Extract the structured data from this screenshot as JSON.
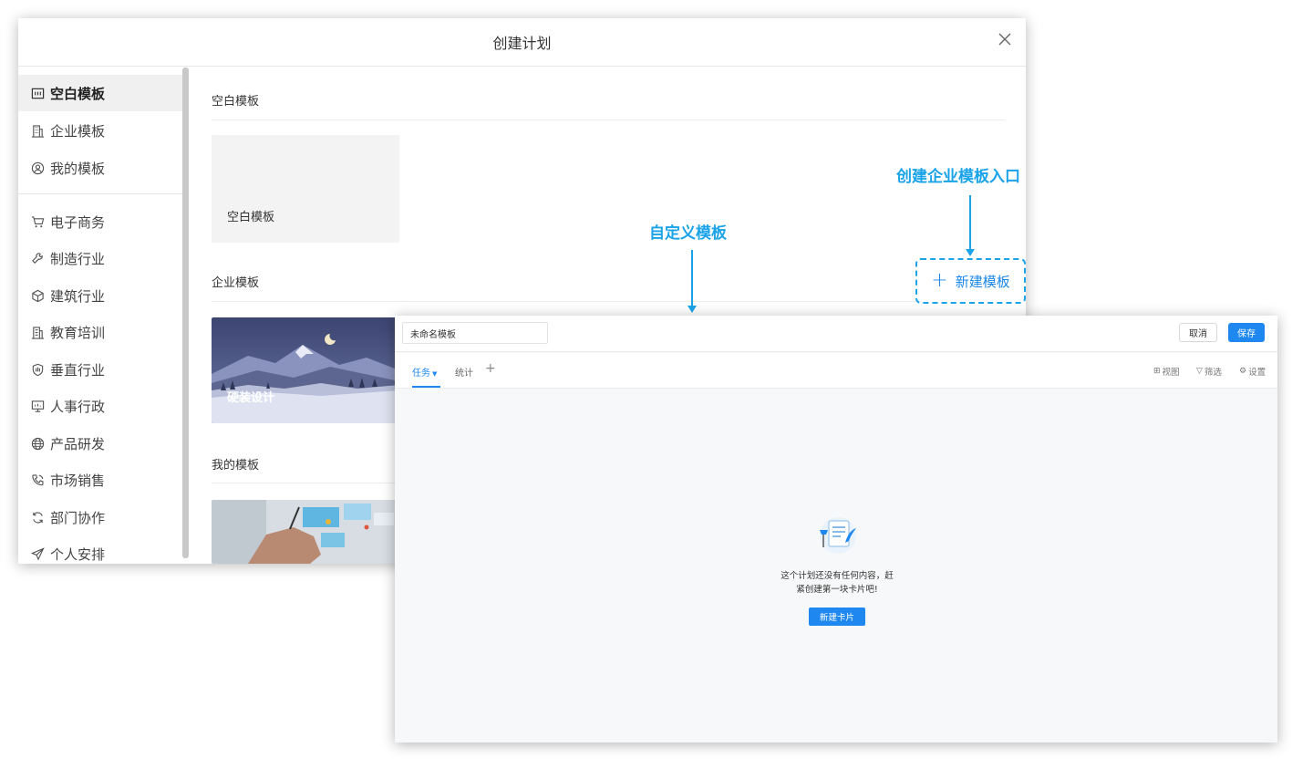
{
  "dialog": {
    "title": "创建计划",
    "sidebar": {
      "top_items": [
        {
          "label": "空白模板",
          "icon": "blank-template-icon",
          "active": true
        },
        {
          "label": "企业模板",
          "icon": "building-icon"
        },
        {
          "label": "我的模板",
          "icon": "user-circle-icon"
        }
      ],
      "category_items": [
        {
          "label": "电子商务",
          "icon": "cart-icon"
        },
        {
          "label": "制造行业",
          "icon": "wrench-icon"
        },
        {
          "label": "建筑行业",
          "icon": "cube-icon"
        },
        {
          "label": "教育培训",
          "icon": "school-icon"
        },
        {
          "label": "垂直行业",
          "icon": "shield-icon"
        },
        {
          "label": "人事行政",
          "icon": "monitor-icon"
        },
        {
          "label": "产品研发",
          "icon": "globe-icon"
        },
        {
          "label": "市场销售",
          "icon": "phone-icon"
        },
        {
          "label": "部门协作",
          "icon": "refresh-icon"
        },
        {
          "label": "个人安排",
          "icon": "send-icon"
        }
      ]
    },
    "sections": {
      "blank": {
        "title": "空白模板",
        "card_label": "空白模板"
      },
      "enterprise": {
        "title": "企业模板",
        "card_label": "硬装设计"
      },
      "mine": {
        "title": "我的模板"
      }
    },
    "new_template_label": "新建模板"
  },
  "annotations": {
    "enterprise_entry": "创建企业模板入口",
    "custom_template": "自定义模板"
  },
  "editor": {
    "name_value": "未命名模板",
    "cancel_label": "取消",
    "save_label": "保存",
    "tabs": {
      "task": "任务",
      "stats": "统计",
      "add": "+"
    },
    "tools": {
      "view": "视图",
      "filter": "筛选",
      "settings": "设置"
    },
    "empty_line1": "这个计划还没有任何内容，赶",
    "empty_line2": "紧创建第一块卡片吧!",
    "new_card_label": "新建卡片"
  },
  "colors": {
    "accent": "#1e88f0",
    "annotation": "#1aa3e8"
  }
}
